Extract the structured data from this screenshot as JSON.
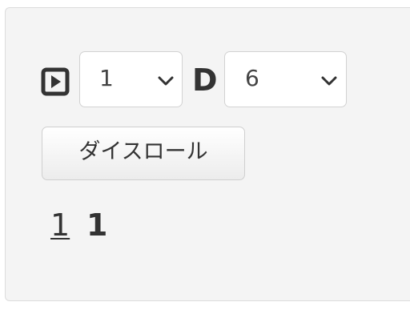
{
  "dice": {
    "count_select": {
      "value": "1",
      "icon": "chevron-down-icon"
    },
    "separator": "D",
    "faces_select": {
      "value": "6",
      "icon": "chevron-down-icon"
    },
    "play_icon": "play-icon"
  },
  "roll_button": {
    "label": "ダイスロール"
  },
  "result": {
    "detail": "1",
    "total": "1"
  }
}
